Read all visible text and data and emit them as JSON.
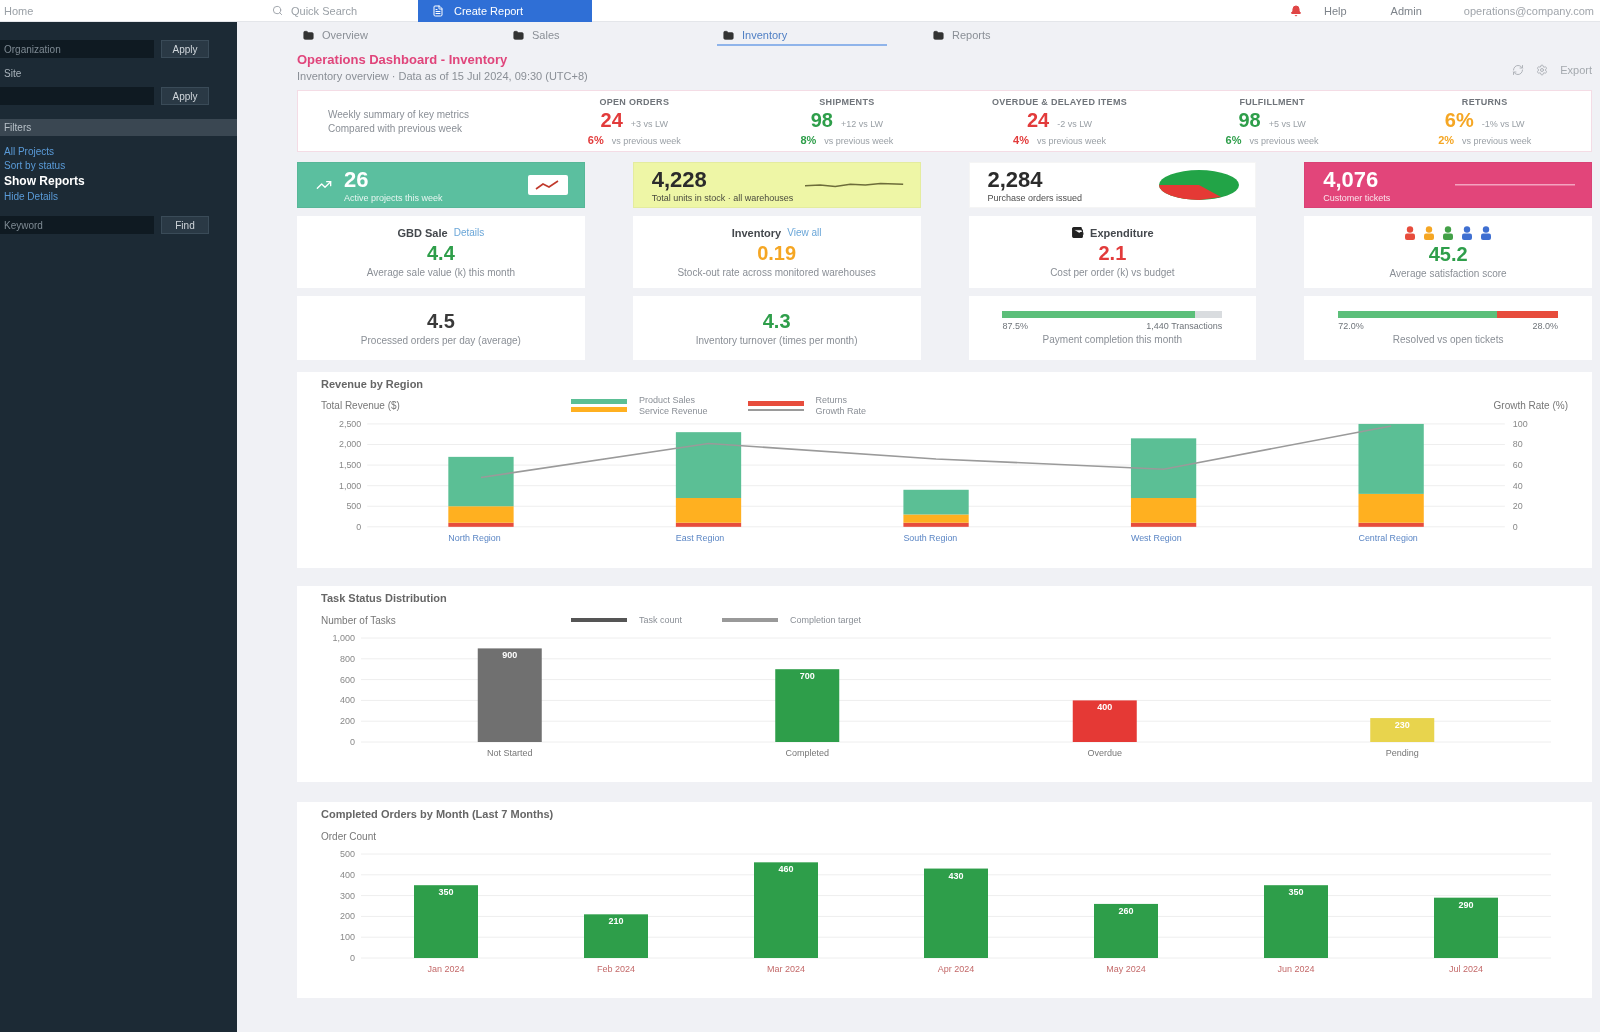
{
  "top_bar": {
    "home": "Home",
    "search": "Quick Search",
    "create_button": "Create Report",
    "links": [
      "Help",
      "Admin"
    ],
    "account": "operations@company.com"
  },
  "sidebar": {
    "fields": [
      {
        "placeholder": "Organization",
        "button": "Apply"
      },
      {
        "label": "Site",
        "button": "Apply"
      }
    ],
    "section": "Filters",
    "nav": [
      {
        "label": "All Projects",
        "selected": false
      },
      {
        "label": "Sort by status",
        "selected": false
      },
      {
        "label": "Show Reports",
        "selected": true
      },
      {
        "label": "Hide Details",
        "selected": false
      }
    ],
    "search": {
      "placeholder": "Keyword",
      "button": "Find"
    }
  },
  "tabs": [
    {
      "label": "Overview",
      "selected": false
    },
    {
      "label": "Sales",
      "selected": false
    },
    {
      "label": "Inventory",
      "selected": true
    },
    {
      "label": "Reports",
      "selected": false
    }
  ],
  "page_header": {
    "title": "Operations Dashboard - Inventory",
    "subtitle": "Inventory overview · Data as of 15 Jul 2024, 09:30 (UTC+8)",
    "action": "Export"
  },
  "kpi_strip": {
    "summary": [
      "Weekly summary of key metrics",
      "Compared with previous week"
    ],
    "items": [
      {
        "title": "OPEN ORDERS",
        "value": "24",
        "note": "+3 vs LW",
        "change": "6%",
        "change_note": "vs previous week",
        "color": "#e23b3b"
      },
      {
        "title": "SHIPMENTS",
        "value": "98",
        "note": "+12 vs LW",
        "change": "8%",
        "change_note": "vs previous week",
        "color": "#2e9e4a"
      },
      {
        "title": "OVERDUE & DELAYED ITEMS",
        "value": "24",
        "note": "-2 vs LW",
        "change": "4%",
        "change_note": "vs previous week",
        "color": "#e23b3b"
      },
      {
        "title": "FULFILLMENT",
        "value": "98",
        "note": "+5 vs LW",
        "change": "6%",
        "change_note": "vs previous week",
        "color": "#2e9e4a"
      },
      {
        "title": "RETURNS",
        "value": "6%",
        "note": "-1% vs LW",
        "change": "2%",
        "change_note": "vs previous week",
        "color": "#f5a623"
      }
    ]
  },
  "cards": [
    {
      "header": {
        "kind": "badge",
        "color": "#5bbf9f",
        "value": "26",
        "caption": "Active projects this week"
      },
      "middle": {
        "kind": "label",
        "label": "GBD Sale",
        "link": "Details",
        "value": "4.4",
        "color": "#2e9e4a",
        "caption": "Average sale value (k) this month"
      },
      "bottom": {
        "kind": "number",
        "value": "4.5",
        "color": "#3a3a3a",
        "caption": "Processed orders per day (average)"
      }
    },
    {
      "header": {
        "kind": "sparkline",
        "color": "#eef6a6",
        "value": "4,228",
        "caption": "Total units in stock · all warehouses"
      },
      "middle": {
        "kind": "label",
        "label": "Inventory",
        "link": "View all",
        "value": "0.19",
        "color": "#f5a623",
        "caption": "Stock-out rate across monitored warehouses"
      },
      "bottom": {
        "kind": "number",
        "value": "4.3",
        "color": "#2e9e4a",
        "caption": "Inventory turnover (times per month)"
      }
    },
    {
      "header": {
        "kind": "pie",
        "color": "#ffffff",
        "value": "2,284",
        "caption": "Purchase orders issued"
      },
      "middle": {
        "kind": "icon_label",
        "label": "Expenditure",
        "value": "2.1",
        "color": "#e23b3b",
        "caption": "Cost per order (k) vs budget"
      },
      "bottom": {
        "kind": "progress",
        "level": 0.875,
        "reading": "87.5%",
        "detail": "1,440 Transactions",
        "caption": "Payment completion this month"
      }
    },
    {
      "header": {
        "kind": "rule",
        "color": "#e2457a",
        "value": "4,076",
        "caption": "Customer tickets"
      },
      "middle": {
        "kind": "people",
        "value": "45.2",
        "color": "#2e9e4a",
        "caption": "Average satisfaction score"
      },
      "bottom": {
        "kind": "split",
        "level": 0.72,
        "reading": "72.0%",
        "detail": "28.0%",
        "caption": "Resolved vs open tickets"
      }
    }
  ],
  "chart_panels": [
    {
      "chart_data": {
        "type": "bar",
        "title": "Revenue by Region",
        "ylabel": "Total Revenue ($)",
        "y2label": "Growth Rate (%)",
        "categories": [
          "North Region",
          "East Region",
          "South Region",
          "West Region",
          "Central Region"
        ],
        "stacked": true,
        "grid": true,
        "series": [
          {
            "name": "Product Sales",
            "color": "#5bbf95",
            "values": [
              1200,
              1600,
              600,
              1450,
              1700
            ]
          },
          {
            "name": "Service Revenue",
            "color": "#ffb020",
            "values": [
              400,
              600,
              200,
              600,
              700
            ]
          },
          {
            "name": "Returns",
            "color": "#e74c3c",
            "values": [
              100,
              100,
              100,
              100,
              100
            ]
          },
          {
            "name": "Growth Rate",
            "type": "line",
            "axis": "y2",
            "color": "#9a9a9a",
            "values": [
              48,
              81,
              66,
              56,
              98
            ]
          }
        ],
        "ylim": [
          0,
          2500
        ],
        "yticks": [
          0,
          500,
          {
            "value": 1000,
            "label": "1,000"
          },
          {
            "value": 1500,
            "label": "1,500"
          },
          {
            "value": 2000,
            "label": "2,000"
          },
          {
            "value": 2500,
            "label": "2,500"
          }
        ],
        "y2lim": [
          0,
          100
        ],
        "y2ticks": [
          0,
          20,
          40,
          60,
          80,
          100
        ]
      }
    },
    {
      "chart_data": {
        "type": "bar",
        "title": "Task Status Distribution",
        "ylabel": "Number of Tasks",
        "annotations": [
          "Task count",
          "Completion target"
        ],
        "categories": [
          "Not Started",
          "Completed",
          "Overdue",
          "Pending"
        ],
        "values": [
          900,
          700,
          400,
          230
        ],
        "colors": [
          "#707070",
          "#2e9e4a",
          "#e53935",
          "#e8d44d"
        ],
        "data_labels": true,
        "grid": true,
        "ylim": [
          0,
          1000
        ],
        "yticks": [
          0,
          200,
          400,
          600,
          800,
          {
            "value": 1000,
            "label": "1,000"
          }
        ]
      }
    },
    {
      "chart_data": {
        "type": "bar",
        "title": "Completed Orders by Month (Last 7 Months)",
        "ylabel": "Order Count",
        "categories": [
          "Jan 2024",
          "Feb 2024",
          "Mar 2024",
          "Apr 2024",
          "May 2024",
          "Jun 2024",
          "Jul 2024"
        ],
        "values": [
          350,
          210,
          460,
          430,
          260,
          350,
          290
        ],
        "color": "#2e9e4a",
        "data_labels": true,
        "grid": true,
        "ylim": [
          0,
          500
        ],
        "yticks": [
          0,
          100,
          200,
          300,
          400,
          500
        ]
      }
    }
  ]
}
